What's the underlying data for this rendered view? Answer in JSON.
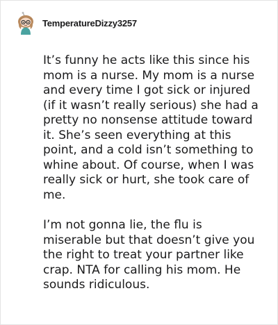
{
  "comment": {
    "username": "TemperatureDizzy3257",
    "avatar_icon": "reddit-snoo-avatar-icon",
    "paragraphs": [
      "It’s funny he acts like this since his mom is a nurse. My mom is a nurse and every time I got sick or injured (if it wasn’t really serious) she had a pretty no nonsense attitude toward it. She’s seen everything at this point, and a cold isn’t something to whine about. Of course, when I was really sick or hurt, she took care of me.",
      "I’m not gonna lie, the flu is miserable but that doesn’t give you the right to treat your partner like crap. NTA for calling his mom. He sounds ridiculous."
    ]
  },
  "colors": {
    "text": "#1a1a1b",
    "avatar_hair": "#b98a5e",
    "avatar_glasses": "#2f2f2f",
    "avatar_shirt": "#4aa3a0"
  }
}
